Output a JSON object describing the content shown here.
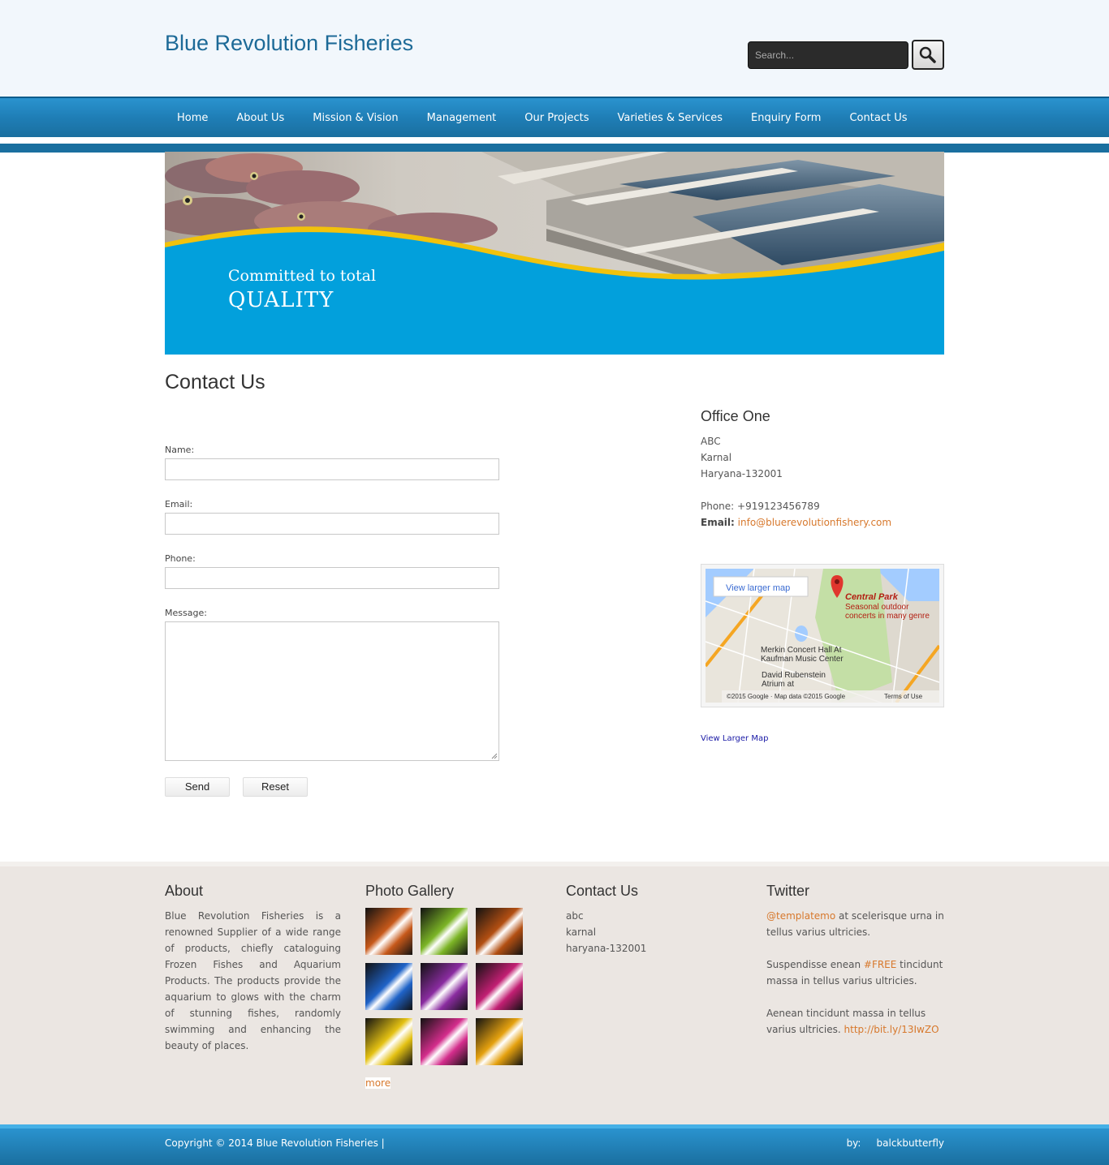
{
  "header": {
    "site_title": "Blue Revolution Fisheries",
    "search_placeholder": "Search..."
  },
  "nav": {
    "items": [
      "Home",
      "About Us",
      "Mission & Vision",
      "Management",
      "Our Projects",
      "Varieties & Services",
      "Enquiry Form",
      "Contact Us"
    ]
  },
  "banner": {
    "line1": "Committed to total",
    "line2": "QUALITY"
  },
  "main": {
    "title": "Contact Us",
    "form": {
      "name_label": "Name:",
      "email_label": "Email:",
      "phone_label": "Phone:",
      "message_label": "Message:",
      "send_label": "Send",
      "reset_label": "Reset"
    },
    "office": {
      "title": "Office One",
      "line1": "ABC",
      "line2": "Karnal",
      "line3": "Haryana-132001",
      "phone": "Phone: +919123456789",
      "email_label": "Email:",
      "email": "info@bluerevolutionfishery.com",
      "map_view_larger": "View larger map",
      "map_place": "Central Park",
      "map_place_desc1": "Seasonal outdoor",
      "map_place_desc2": "concerts in many genre",
      "map_label1": "Merkin Concert Hall At",
      "map_label2": "Kaufman Music Center",
      "map_label3": "David Rubenstein",
      "map_label4": "Atrium at",
      "map_credit": "©2015 Google · Map data ©2015 Google",
      "map_terms": "Terms of Use",
      "map_link": "View Larger Map"
    }
  },
  "footer": {
    "about": {
      "title": "About",
      "text": "Blue Revolution Fisheries is a renowned Supplier of a wide range of products, chiefly cataloguing Frozen Fishes and Aquarium Products. The products provide the aquarium to glows with the charm of stunning fishes, randomly swimming and enhancing the beauty of places."
    },
    "gallery": {
      "title": "Photo Gallery",
      "more": "more",
      "colors": [
        "#c7591a",
        "#7cb526",
        "#b34f12",
        "#1f63c8",
        "#8a2ca0",
        "#c21f73",
        "#e4c112",
        "#d42d8c",
        "#e5a10f"
      ]
    },
    "contact": {
      "title": "Contact Us",
      "line1": "abc",
      "line2": "karnal",
      "line3": "haryana-132001"
    },
    "twitter": {
      "title": "Twitter",
      "t1_handle": "@templatemo",
      "t1_text1": " at scelerisque urna in",
      "t1_text2": "tellus varius ultricies.",
      "t2_text1": "Suspendisse enean ",
      "t2_tag": "#FREE",
      "t2_text2": " tincidunt",
      "t2_text3": "massa in tellus varius ultricies.",
      "t3_text1": "Aenean tincidunt massa in tellus",
      "t3_text2": "varius ultricies. ",
      "t3_link": "http://bit.ly/13IwZO"
    }
  },
  "bottom": {
    "copyright": "Copyright © 2014 Blue Revolution Fisheries |",
    "by_label": "by:",
    "by_name": "balckbutterfly"
  }
}
